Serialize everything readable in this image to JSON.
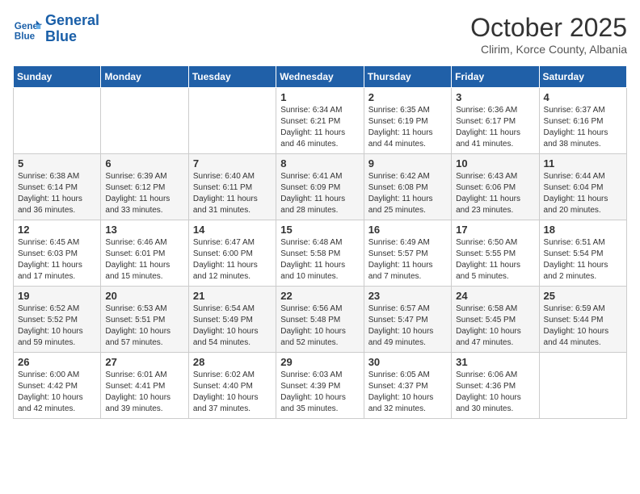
{
  "header": {
    "logo_line1": "General",
    "logo_line2": "Blue",
    "month": "October 2025",
    "location": "Clirim, Korce County, Albania"
  },
  "weekdays": [
    "Sunday",
    "Monday",
    "Tuesday",
    "Wednesday",
    "Thursday",
    "Friday",
    "Saturday"
  ],
  "weeks": [
    [
      {
        "day": "",
        "info": ""
      },
      {
        "day": "",
        "info": ""
      },
      {
        "day": "",
        "info": ""
      },
      {
        "day": "1",
        "info": "Sunrise: 6:34 AM\nSunset: 6:21 PM\nDaylight: 11 hours\nand 46 minutes."
      },
      {
        "day": "2",
        "info": "Sunrise: 6:35 AM\nSunset: 6:19 PM\nDaylight: 11 hours\nand 44 minutes."
      },
      {
        "day": "3",
        "info": "Sunrise: 6:36 AM\nSunset: 6:17 PM\nDaylight: 11 hours\nand 41 minutes."
      },
      {
        "day": "4",
        "info": "Sunrise: 6:37 AM\nSunset: 6:16 PM\nDaylight: 11 hours\nand 38 minutes."
      }
    ],
    [
      {
        "day": "5",
        "info": "Sunrise: 6:38 AM\nSunset: 6:14 PM\nDaylight: 11 hours\nand 36 minutes."
      },
      {
        "day": "6",
        "info": "Sunrise: 6:39 AM\nSunset: 6:12 PM\nDaylight: 11 hours\nand 33 minutes."
      },
      {
        "day": "7",
        "info": "Sunrise: 6:40 AM\nSunset: 6:11 PM\nDaylight: 11 hours\nand 31 minutes."
      },
      {
        "day": "8",
        "info": "Sunrise: 6:41 AM\nSunset: 6:09 PM\nDaylight: 11 hours\nand 28 minutes."
      },
      {
        "day": "9",
        "info": "Sunrise: 6:42 AM\nSunset: 6:08 PM\nDaylight: 11 hours\nand 25 minutes."
      },
      {
        "day": "10",
        "info": "Sunrise: 6:43 AM\nSunset: 6:06 PM\nDaylight: 11 hours\nand 23 minutes."
      },
      {
        "day": "11",
        "info": "Sunrise: 6:44 AM\nSunset: 6:04 PM\nDaylight: 11 hours\nand 20 minutes."
      }
    ],
    [
      {
        "day": "12",
        "info": "Sunrise: 6:45 AM\nSunset: 6:03 PM\nDaylight: 11 hours\nand 17 minutes."
      },
      {
        "day": "13",
        "info": "Sunrise: 6:46 AM\nSunset: 6:01 PM\nDaylight: 11 hours\nand 15 minutes."
      },
      {
        "day": "14",
        "info": "Sunrise: 6:47 AM\nSunset: 6:00 PM\nDaylight: 11 hours\nand 12 minutes."
      },
      {
        "day": "15",
        "info": "Sunrise: 6:48 AM\nSunset: 5:58 PM\nDaylight: 11 hours\nand 10 minutes."
      },
      {
        "day": "16",
        "info": "Sunrise: 6:49 AM\nSunset: 5:57 PM\nDaylight: 11 hours\nand 7 minutes."
      },
      {
        "day": "17",
        "info": "Sunrise: 6:50 AM\nSunset: 5:55 PM\nDaylight: 11 hours\nand 5 minutes."
      },
      {
        "day": "18",
        "info": "Sunrise: 6:51 AM\nSunset: 5:54 PM\nDaylight: 11 hours\nand 2 minutes."
      }
    ],
    [
      {
        "day": "19",
        "info": "Sunrise: 6:52 AM\nSunset: 5:52 PM\nDaylight: 10 hours\nand 59 minutes."
      },
      {
        "day": "20",
        "info": "Sunrise: 6:53 AM\nSunset: 5:51 PM\nDaylight: 10 hours\nand 57 minutes."
      },
      {
        "day": "21",
        "info": "Sunrise: 6:54 AM\nSunset: 5:49 PM\nDaylight: 10 hours\nand 54 minutes."
      },
      {
        "day": "22",
        "info": "Sunrise: 6:56 AM\nSunset: 5:48 PM\nDaylight: 10 hours\nand 52 minutes."
      },
      {
        "day": "23",
        "info": "Sunrise: 6:57 AM\nSunset: 5:47 PM\nDaylight: 10 hours\nand 49 minutes."
      },
      {
        "day": "24",
        "info": "Sunrise: 6:58 AM\nSunset: 5:45 PM\nDaylight: 10 hours\nand 47 minutes."
      },
      {
        "day": "25",
        "info": "Sunrise: 6:59 AM\nSunset: 5:44 PM\nDaylight: 10 hours\nand 44 minutes."
      }
    ],
    [
      {
        "day": "26",
        "info": "Sunrise: 6:00 AM\nSunset: 4:42 PM\nDaylight: 10 hours\nand 42 minutes."
      },
      {
        "day": "27",
        "info": "Sunrise: 6:01 AM\nSunset: 4:41 PM\nDaylight: 10 hours\nand 39 minutes."
      },
      {
        "day": "28",
        "info": "Sunrise: 6:02 AM\nSunset: 4:40 PM\nDaylight: 10 hours\nand 37 minutes."
      },
      {
        "day": "29",
        "info": "Sunrise: 6:03 AM\nSunset: 4:39 PM\nDaylight: 10 hours\nand 35 minutes."
      },
      {
        "day": "30",
        "info": "Sunrise: 6:05 AM\nSunset: 4:37 PM\nDaylight: 10 hours\nand 32 minutes."
      },
      {
        "day": "31",
        "info": "Sunrise: 6:06 AM\nSunset: 4:36 PM\nDaylight: 10 hours\nand 30 minutes."
      },
      {
        "day": "",
        "info": ""
      }
    ]
  ]
}
